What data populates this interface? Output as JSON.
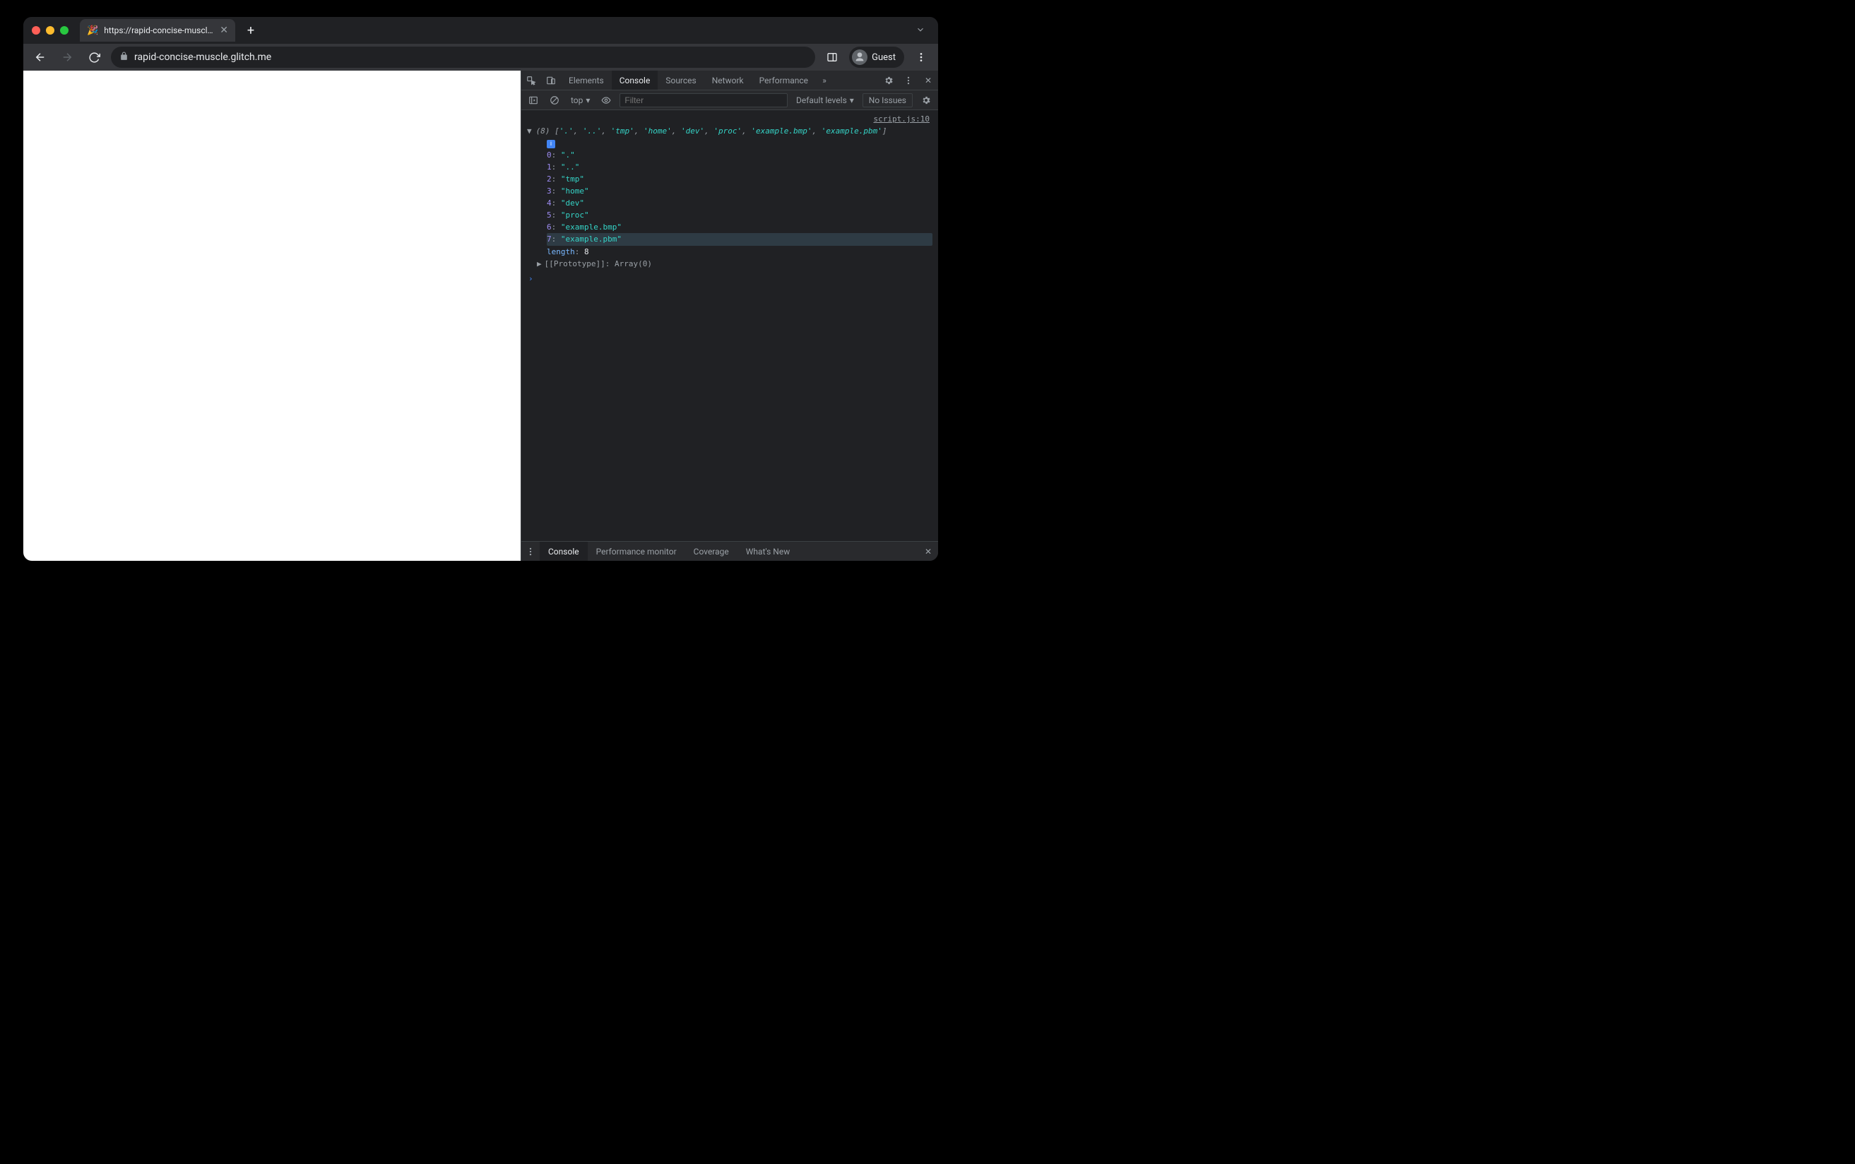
{
  "browser": {
    "tab": {
      "favicon": "🎉",
      "title": "https://rapid-concise-muscle.g"
    },
    "url": "rapid-concise-muscle.glitch.me",
    "profile_label": "Guest"
  },
  "devtools": {
    "tabs": {
      "elements": "Elements",
      "console": "Console",
      "sources": "Sources",
      "network": "Network",
      "performance": "Performance"
    },
    "toolbar": {
      "context": "top",
      "filter_placeholder": "Filter",
      "levels": "Default levels",
      "issues": "No Issues"
    },
    "console": {
      "source_link": "script.js:10",
      "array_length_label": "(8)",
      "array_preview": [
        "'.'",
        "'..'",
        "'tmp'",
        "'home'",
        "'dev'",
        "'proc'",
        "'example.bmp'",
        "'example.pbm'"
      ],
      "items": [
        {
          "idx": "0",
          "val": "\".\""
        },
        {
          "idx": "1",
          "val": "\"..\""
        },
        {
          "idx": "2",
          "val": "\"tmp\""
        },
        {
          "idx": "3",
          "val": "\"home\""
        },
        {
          "idx": "4",
          "val": "\"dev\""
        },
        {
          "idx": "5",
          "val": "\"proc\""
        },
        {
          "idx": "6",
          "val": "\"example.bmp\""
        },
        {
          "idx": "7",
          "val": "\"example.pbm\""
        }
      ],
      "length_key": "length",
      "length_val": "8",
      "prototype_label": "[[Prototype]]",
      "prototype_val": "Array(0)",
      "info_badge": "i"
    },
    "drawer": {
      "console": "Console",
      "perfmon": "Performance monitor",
      "coverage": "Coverage",
      "whatsnew": "What's New"
    }
  }
}
